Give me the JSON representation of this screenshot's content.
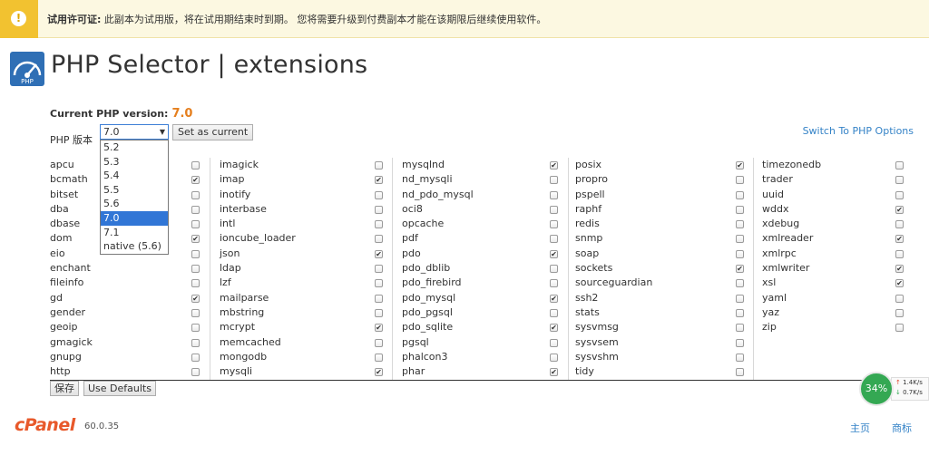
{
  "banner": {
    "icon": "warning-icon",
    "title": "试用许可证:",
    "text": " 此副本为试用版，将在试用期结束时到期。 您将需要升级到付费副本才能在该期限后继续使用软件。"
  },
  "header": {
    "title": "PHP Selector | extensions",
    "logo_icon": "php-selector-gauge-icon"
  },
  "current": {
    "label": "Current PHP version:",
    "version": "7.0"
  },
  "selector": {
    "label": "PHP 版本",
    "value": "7.0",
    "set_current_label": "Set as current",
    "options": [
      "5.2",
      "5.3",
      "5.4",
      "5.5",
      "5.6",
      "7.0",
      "7.1",
      "native (5.6)"
    ],
    "selected_index": 5
  },
  "switch_link": "Switch To PHP Options",
  "extensions": [
    [
      {
        "name": "apcu",
        "checked": false
      },
      {
        "name": "bcmath",
        "checked": true
      },
      {
        "name": "bitset",
        "checked": false
      },
      {
        "name": "dba",
        "checked": false
      },
      {
        "name": "dbase",
        "checked": false
      },
      {
        "name": "dom",
        "checked": true
      },
      {
        "name": "eio",
        "checked": false
      },
      {
        "name": "enchant",
        "checked": false
      },
      {
        "name": "fileinfo",
        "checked": false
      },
      {
        "name": "gd",
        "checked": true
      },
      {
        "name": "gender",
        "checked": false
      },
      {
        "name": "geoip",
        "checked": false
      },
      {
        "name": "gmagick",
        "checked": false
      },
      {
        "name": "gnupg",
        "checked": false
      },
      {
        "name": "http",
        "checked": false
      }
    ],
    [
      {
        "name": "imagick",
        "checked": false
      },
      {
        "name": "imap",
        "checked": true
      },
      {
        "name": "inotify",
        "checked": false
      },
      {
        "name": "interbase",
        "checked": false
      },
      {
        "name": "intl",
        "checked": false
      },
      {
        "name": "ioncube_loader",
        "checked": false
      },
      {
        "name": "json",
        "checked": true
      },
      {
        "name": "ldap",
        "checked": false
      },
      {
        "name": "lzf",
        "checked": false
      },
      {
        "name": "mailparse",
        "checked": false
      },
      {
        "name": "mbstring",
        "checked": false
      },
      {
        "name": "mcrypt",
        "checked": true
      },
      {
        "name": "memcached",
        "checked": false
      },
      {
        "name": "mongodb",
        "checked": false
      },
      {
        "name": "mysqli",
        "checked": true
      }
    ],
    [
      {
        "name": "mysqlnd",
        "checked": true
      },
      {
        "name": "nd_mysqli",
        "checked": false
      },
      {
        "name": "nd_pdo_mysql",
        "checked": false
      },
      {
        "name": "oci8",
        "checked": false
      },
      {
        "name": "opcache",
        "checked": false
      },
      {
        "name": "pdf",
        "checked": false
      },
      {
        "name": "pdo",
        "checked": true
      },
      {
        "name": "pdo_dblib",
        "checked": false
      },
      {
        "name": "pdo_firebird",
        "checked": false
      },
      {
        "name": "pdo_mysql",
        "checked": true
      },
      {
        "name": "pdo_pgsql",
        "checked": false
      },
      {
        "name": "pdo_sqlite",
        "checked": true
      },
      {
        "name": "pgsql",
        "checked": false
      },
      {
        "name": "phalcon3",
        "checked": false
      },
      {
        "name": "phar",
        "checked": true
      }
    ],
    [
      {
        "name": "posix",
        "checked": true
      },
      {
        "name": "propro",
        "checked": false
      },
      {
        "name": "pspell",
        "checked": false
      },
      {
        "name": "raphf",
        "checked": false
      },
      {
        "name": "redis",
        "checked": false
      },
      {
        "name": "snmp",
        "checked": false
      },
      {
        "name": "soap",
        "checked": false
      },
      {
        "name": "sockets",
        "checked": true
      },
      {
        "name": "sourceguardian",
        "checked": false
      },
      {
        "name": "ssh2",
        "checked": false
      },
      {
        "name": "stats",
        "checked": false
      },
      {
        "name": "sysvmsg",
        "checked": false
      },
      {
        "name": "sysvsem",
        "checked": false
      },
      {
        "name": "sysvshm",
        "checked": false
      },
      {
        "name": "tidy",
        "checked": false
      }
    ],
    [
      {
        "name": "timezonedb",
        "checked": false
      },
      {
        "name": "trader",
        "checked": false
      },
      {
        "name": "uuid",
        "checked": false
      },
      {
        "name": "wddx",
        "checked": true
      },
      {
        "name": "xdebug",
        "checked": false
      },
      {
        "name": "xmlreader",
        "checked": true
      },
      {
        "name": "xmlrpc",
        "checked": false
      },
      {
        "name": "xmlwriter",
        "checked": true
      },
      {
        "name": "xsl",
        "checked": true
      },
      {
        "name": "yaml",
        "checked": false
      },
      {
        "name": "yaz",
        "checked": false
      },
      {
        "name": "zip",
        "checked": false
      }
    ]
  ],
  "actions": {
    "save_label": "保存",
    "defaults_label": "Use Defaults"
  },
  "footer": {
    "brand": "cPanel",
    "version": "60.0.35",
    "home_label": "主页",
    "trademark_label": "商标"
  },
  "speed": {
    "percent": "34%",
    "upload": "1.4K/s",
    "download": "0.7K/s"
  },
  "colors": {
    "version_accent": "#e57f1e",
    "link": "#3583c7",
    "banner_bg": "#fcf8e1",
    "selected_option": "#3176d6"
  }
}
